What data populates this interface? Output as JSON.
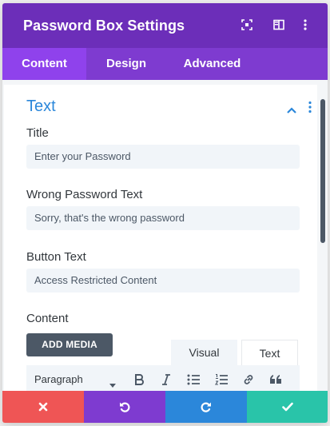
{
  "header": {
    "title": "Password Box Settings",
    "icons": [
      "expand-icon",
      "sidebar-layout-icon",
      "more-vertical-icon"
    ]
  },
  "tabs": [
    {
      "label": "Content",
      "active": true
    },
    {
      "label": "Design",
      "active": false
    },
    {
      "label": "Advanced",
      "active": false
    }
  ],
  "section": {
    "title": "Text",
    "collapsed": false
  },
  "fields": {
    "title": {
      "label": "Title",
      "value": "Enter your Password"
    },
    "wrong_password": {
      "label": "Wrong Password Text",
      "value": "Sorry, that's the wrong password"
    },
    "button_text": {
      "label": "Button Text",
      "value": "Access Restricted Content"
    },
    "content": {
      "label": "Content"
    }
  },
  "editor": {
    "add_media_label": "ADD MEDIA",
    "tab_visual": "Visual",
    "tab_text": "Text",
    "format_selected": "Paragraph",
    "toolbar_icons": [
      "bold-icon",
      "italic-icon",
      "bullet-list-icon",
      "numbered-list-icon",
      "link-icon",
      "blockquote-icon"
    ]
  },
  "footer": {
    "buttons": [
      {
        "name": "cancel",
        "color": "#ef5555"
      },
      {
        "name": "undo",
        "color": "#7e3bd0"
      },
      {
        "name": "redo",
        "color": "#2b87da"
      },
      {
        "name": "save",
        "color": "#29c4a9"
      }
    ]
  },
  "colors": {
    "header": "#6c2eb9",
    "tabs": "#7e3bd0",
    "active_tab": "#8f42ec",
    "section_title": "#2b87da"
  }
}
